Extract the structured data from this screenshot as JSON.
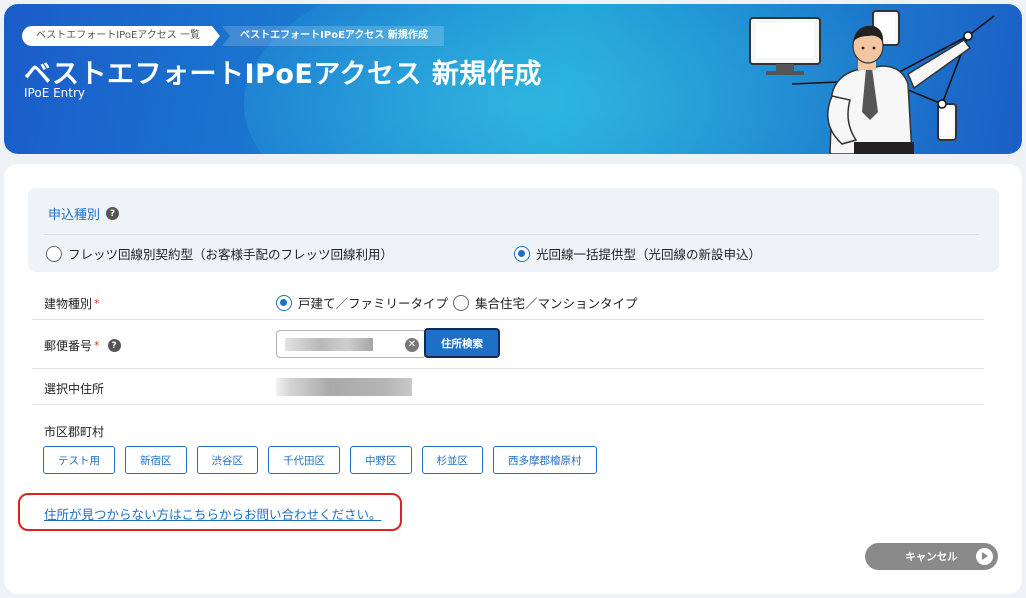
{
  "header": {
    "breadcrumb": [
      "ベストエフォートIPoEアクセス 一覧",
      "ベストエフォートIPoEアクセス 新規作成"
    ],
    "title": "ベストエフォートIPoEアクセス 新規作成",
    "subtitle": "IPoE Entry"
  },
  "application_type": {
    "label": "申込種別",
    "options": [
      {
        "label": "フレッツ回線別契約型（お客様手配のフレッツ回線利用）",
        "selected": false
      },
      {
        "label": "光回線一括提供型（光回線の新設申込）",
        "selected": true
      }
    ]
  },
  "building_type": {
    "label": "建物種別",
    "required_mark": "*",
    "options": [
      {
        "label": "戸建て／ファミリータイプ",
        "selected": true
      },
      {
        "label": "集合住宅／マンションタイプ",
        "selected": false
      }
    ]
  },
  "postal_code": {
    "label": "郵便番号",
    "required_mark": "*",
    "search_button": "住所検索"
  },
  "selected_address": {
    "label": "選択中住所"
  },
  "municipality": {
    "label": "市区郡町村",
    "cities": [
      "テスト用",
      "新宿区",
      "渋谷区",
      "千代田区",
      "中野区",
      "杉並区",
      "西多摩郡檜原村"
    ]
  },
  "contact_link": "住所が見つからない方はこちらからお問い合わせください。",
  "footer": {
    "cancel_label": "キャンセル"
  },
  "colors": {
    "accent": "#1e6fc5",
    "highlight": "#e02020",
    "required": "#dd3333"
  }
}
